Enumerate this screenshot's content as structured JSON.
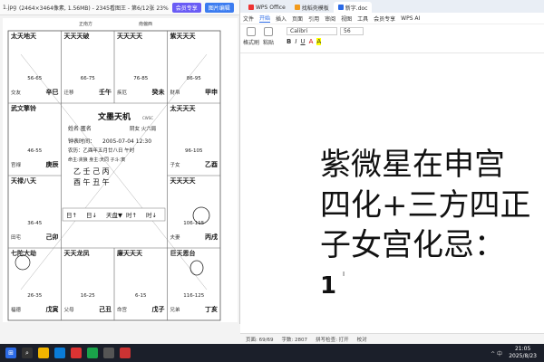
{
  "viewer": {
    "filename": "1.jpg",
    "info": "(2464×3464像素, 1.56MB) - 2345看图王 - 第6/12张 23%",
    "btn_member": "会员专享",
    "btn_edit": "图片编辑"
  },
  "chart": {
    "top_branches": [
      "正南方",
      "南偏西"
    ],
    "center_title": "文墨天机",
    "center_sub": "CWSC",
    "name_label": "姓名  匿名",
    "gender_label": "阴女  火六局",
    "clock_label": "钟表时间：",
    "clock_value": "2005-07-04  12:30",
    "lunar_line": "农历：乙酉年五月廿八日 午时",
    "extra_line": "命主:贪狼  身主:天同  子斗:寅",
    "pillars": [
      "乙 壬 己 丙",
      "酉 午 丑 午"
    ],
    "nav_buttons": [
      "日↑",
      "日↓",
      "天盘▼",
      "时↑",
      "时↓"
    ],
    "cells": [
      {
        "stars": "太天地天",
        "mid": "56-65",
        "branch": "辛巳",
        "palace": "交友"
      },
      {
        "stars": "天天天破",
        "mid": "66-75",
        "branch": "壬午",
        "palace": "迁移"
      },
      {
        "stars": "天天天天",
        "mid": "76-85",
        "branch": "癸未",
        "palace": "疾厄"
      },
      {
        "stars": "紫天天天",
        "mid": "86-95",
        "branch": "甲申",
        "palace": "财帛"
      },
      {
        "stars": "武文擎铃",
        "mid": "46-55",
        "branch": "庚辰",
        "palace": "官禄"
      },
      {
        "stars": "太天天天",
        "mid": "96-105",
        "branch": "乙酉",
        "palace": "子女"
      },
      {
        "stars": "天禄八天",
        "mid": "36-45",
        "branch": "己卯",
        "palace": "田宅"
      },
      {
        "stars": "天天天天",
        "mid": "106-115",
        "branch": "丙戌",
        "palace": "夫妻"
      },
      {
        "stars": "七陀大劫",
        "mid": "26-35",
        "branch": "戊寅",
        "palace": "福德"
      },
      {
        "stars": "天天龙凤",
        "mid": "16-25",
        "branch": "己丑",
        "palace": "父母"
      },
      {
        "stars": "廉天天天",
        "mid": "6-15",
        "branch": "戊子",
        "palace": "命宫"
      },
      {
        "stars": "巨天恩台",
        "mid": "116-125",
        "branch": "丁亥",
        "palace": "兄弟"
      }
    ]
  },
  "wps": {
    "tabs": [
      "WPS Office",
      "找稻壳模板",
      "新字.doc"
    ],
    "menu": [
      "文件",
      "开始",
      "插入",
      "页面",
      "引用",
      "审阅",
      "视图",
      "工具",
      "会员专享",
      "WPS AI"
    ],
    "font_name": "Calibri",
    "font_size": "56",
    "style_label": "格式刷",
    "paste_label": "粘贴",
    "doc_lines": [
      "紫微星在申宫",
      "四化+三方四正",
      "子女宫化忌：",
      "1"
    ],
    "status": [
      "页面: 69/69",
      "字数: 2807",
      "拼写检查: 打开",
      "校对"
    ]
  },
  "taskbar": {
    "time": "21:05",
    "date": "2025/8/23",
    "tray": "^ 中"
  }
}
